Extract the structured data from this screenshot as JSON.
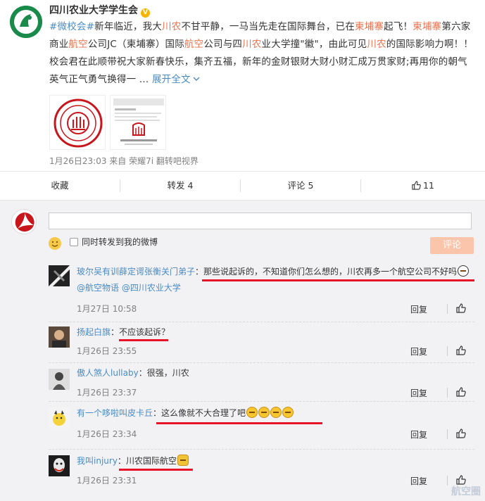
{
  "post": {
    "author": "四川农业大学学生会",
    "text": {
      "tag": "#微校会#",
      "p1": "新年临近，我大",
      "h1": "川农",
      "p2": "不甘平静，一马当先走在国际舞台，已在",
      "h2": "柬埔寨",
      "p3": "起飞！",
      "h3": "柬埔寨",
      "p4": "第六家商业",
      "h4": "航空",
      "p5": "公司JC（柬埔寨）国际",
      "h5": "航空",
      "p6": "公司与四",
      "h6": "川农",
      "p7": "业大学撞\"徽\"，由此可见",
      "h7": "川农",
      "p8": "的国际影响力啊！！校会君在此顺带祝大家新春快乐，集齐五福，新年的金财银财大财小财汇成万贯家财;再用你的朝气英气正气勇气换得一 … ",
      "more": "展开全文",
      "more_icon": "chevron-down-icon"
    },
    "meta": "1月26日23:03 来自 荣耀7i 翻转吧视界"
  },
  "actions": {
    "favorite": "收藏",
    "repost": "转发 4",
    "comment": "评论 5",
    "like": "11"
  },
  "composer": {
    "placeholder": "",
    "repost_label": "同时转发到我的微博",
    "submit_label": "评论"
  },
  "comments": [
    {
      "user": "玻尔吴有训薛定谔张衡关门弟子",
      "text": "那些说起诉的，不知道你们怎么想的，川农再多一个航空公司不好吗",
      "mentions": "@航空物语 @四川农业大学",
      "time": "1月27日 10:58",
      "reply": "回复"
    },
    {
      "user": "扬起白旗",
      "text": "不应该起诉？",
      "time": "1月26日 23:55",
      "reply": "回复"
    },
    {
      "user": "傲人煞人lullaby",
      "text": "很强，川农",
      "time": "1月26日 23:37",
      "reply": "回复"
    },
    {
      "user": "有一个哆啦叫皮卡丘",
      "text": "这么像就不大合理了吧",
      "time": "1月26日 23:34",
      "reply": "回复"
    },
    {
      "user": "我叫injury",
      "text": "川农国际航空",
      "time": "1月26日 23:31",
      "reply": "回复"
    }
  ],
  "watermark": "航空圈",
  "colors": {
    "link": "#4a8bc2",
    "highlight": "#eb7350",
    "annotation_red": "#e8142a",
    "submit_bg": "#fbc5ac",
    "comments_bg": "#f2f2f5"
  }
}
